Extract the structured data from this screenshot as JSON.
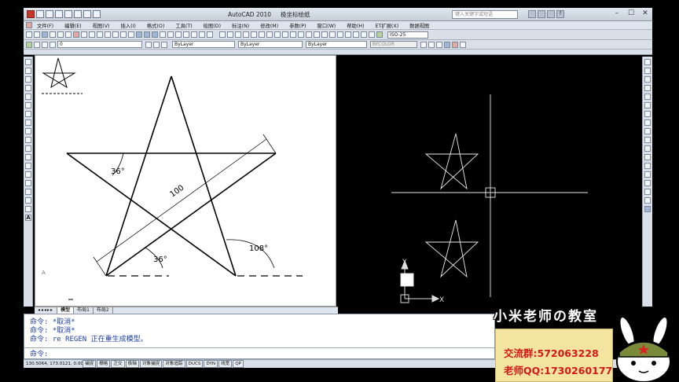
{
  "window": {
    "app_title": "AutoCAD 2010",
    "doc_title": "极坐标绘纸",
    "search_placeholder": "键入关键字或短语"
  },
  "menu": [
    "文件(F)",
    "编辑(E)",
    "视图(V)",
    "插入(I)",
    "格式(O)",
    "工具(T)",
    "绘图(D)",
    "标注(N)",
    "修改(M)",
    "参数(P)",
    "窗口(W)",
    "帮助(H)",
    "ET扩展(X)",
    "数据视图"
  ],
  "toolbar": {
    "layer_value": "0",
    "color_value": "ByLayer",
    "linetype_value": "ByLayer",
    "lineweight_value": "ByLayer",
    "plotstyle_value": "BYCOLOR",
    "dimstyle_value": "ISO-25"
  },
  "drawing": {
    "angle_top": "36°",
    "length": "100",
    "angle_bottom": "36°",
    "angle_right": "108°",
    "marker": "A"
  },
  "ucs": {
    "x": "X",
    "y": "Y"
  },
  "tabs": [
    "模型",
    "布局1",
    "布局2"
  ],
  "command": {
    "lines": [
      "命令: *取消*",
      "命令: *取消*",
      "命令: re REGEN 正在重生成模型。"
    ],
    "prompt": "命令:"
  },
  "status": {
    "coords": "130.5064, 173.0121, 0.0000",
    "buttons": [
      "捕捉",
      "栅格",
      "正交",
      "极轴",
      "对象捕捉",
      "对象追踪",
      "DUCS",
      "DYN",
      "线宽",
      "QP"
    ]
  },
  "overlay": {
    "brand": "小米老师の教室",
    "group_label": "交流群:",
    "group_value": "572063228",
    "qq_label": "老师QQ:",
    "qq_value": "1730260177"
  }
}
